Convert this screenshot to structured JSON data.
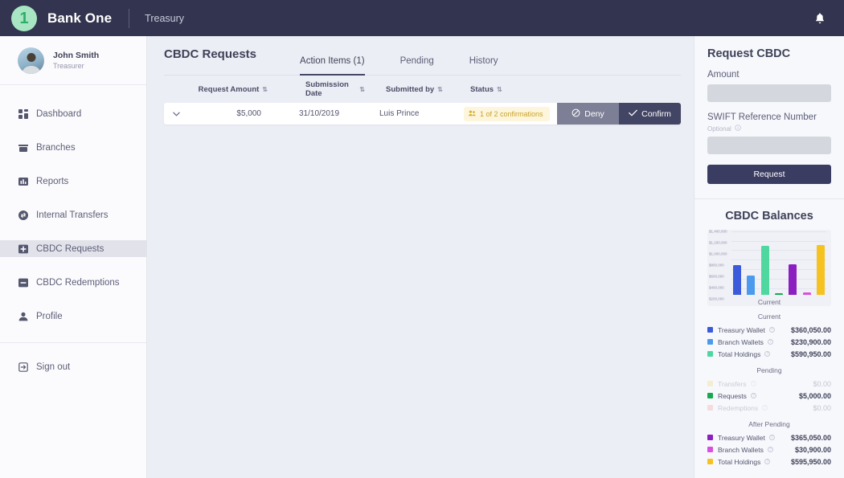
{
  "header": {
    "logo_text": "1",
    "brand": "Bank One",
    "sub_brand": "Treasury",
    "bell_icon": "bell-icon"
  },
  "sidebar": {
    "profile": {
      "name": "John Smith",
      "role": "Treasurer",
      "avatar_icon": "avatar"
    },
    "items": [
      {
        "label": "Dashboard",
        "icon": "dashboard-icon",
        "active": false
      },
      {
        "label": "Branches",
        "icon": "branches-icon",
        "active": false
      },
      {
        "label": "Reports",
        "icon": "reports-icon",
        "active": false
      },
      {
        "label": "Internal Transfers",
        "icon": "transfers-icon",
        "active": false
      },
      {
        "label": "CBDC Requests",
        "icon": "cbdc-requests-icon",
        "active": true
      },
      {
        "label": "CBDC Redemptions",
        "icon": "cbdc-redemptions-icon",
        "active": false
      },
      {
        "label": "Profile",
        "icon": "profile-icon",
        "active": false
      }
    ],
    "signout": {
      "label": "Sign out",
      "icon": "signout-icon"
    }
  },
  "main": {
    "title": "CBDC Requests",
    "tabs": [
      {
        "label": "Action Items (1)",
        "active": true
      },
      {
        "label": "Pending",
        "active": false
      },
      {
        "label": "History",
        "active": false
      }
    ],
    "columns": [
      {
        "label": "Request Amount",
        "sort": "⇅"
      },
      {
        "label": "Submission Date",
        "sort": "⇅"
      },
      {
        "label": "Submitted by",
        "sort": "⇅"
      },
      {
        "label": "Status",
        "sort": "⇅"
      }
    ],
    "rows": [
      {
        "expand_icon": "chevron-down-icon",
        "amount": "$5,000",
        "date": "31/10/2019",
        "submitted_by": "Luis Prince",
        "status": "1 of 2 confirmations",
        "status_icon": "users-icon",
        "deny_label": "Deny",
        "confirm_label": "Confirm"
      }
    ]
  },
  "request_panel": {
    "title": "Request CBDC",
    "amount_label": "Amount",
    "amount_value": "",
    "amount_placeholder": "",
    "swift_label": "SWIFT Reference Number",
    "swift_optional": "Optional",
    "swift_value": "",
    "swift_placeholder": "",
    "button_label": "Request"
  },
  "balances": {
    "title": "CBDC Balances",
    "groups": [
      {
        "name": "Current",
        "faded": false,
        "rows": [
          {
            "label": "Treasury Wallet",
            "value": "$360,050.00",
            "color": "#3b5bdb",
            "faded": false
          },
          {
            "label": "Branch Wallets",
            "value": "$230,900.00",
            "color": "#4c9aed",
            "faded": false
          },
          {
            "label": "Total Holdings",
            "value": "$590,950.00",
            "color": "#4ed8a0",
            "faded": false
          }
        ]
      },
      {
        "name": "Pending",
        "faded": false,
        "rows": [
          {
            "label": "Transfers",
            "value": "$0.00",
            "color": "#f2cf5b",
            "faded": true
          },
          {
            "label": "Requests",
            "value": "$5,000.00",
            "color": "#17a94f",
            "faded": false
          },
          {
            "label": "Redemptions",
            "value": "$0.00",
            "color": "#ef8f8f",
            "faded": true
          }
        ]
      },
      {
        "name": "After Pending",
        "faded": false,
        "rows": [
          {
            "label": "Treasury Wallet",
            "value": "$365,050.00",
            "color": "#8b1fbf",
            "faded": false
          },
          {
            "label": "Branch Wallets",
            "value": "$30,900.00",
            "color": "#d94fe0",
            "faded": false
          },
          {
            "label": "Total Holdings",
            "value": "$595,950.00",
            "color": "#f5c220",
            "faded": false
          }
        ]
      }
    ]
  },
  "chart_data": {
    "type": "bar",
    "title": "CBDC Balances",
    "xlabel": "Current",
    "ylabel": "",
    "grid": true,
    "legend_position": "below",
    "ylim": [
      0,
      1400000
    ],
    "yticks": [
      "$1,400,000",
      "$1,200,000",
      "$1,000,000",
      "$800,000",
      "$600,000",
      "$400,000",
      "$200,000"
    ],
    "categories": [
      "Treasury Wallet",
      "Branch Wallets",
      "Total Holdings",
      "Pending Requests",
      "After Treasury Wallet",
      "After Branch Wallets",
      "After Total Holdings"
    ],
    "values": [
      360050,
      230900,
      590950,
      5000,
      365050,
      30900,
      595950
    ],
    "colors": [
      "#3b5bdb",
      "#4c9aed",
      "#4ed8a0",
      "#17a94f",
      "#8b1fbf",
      "#d94fe0",
      "#f5c220"
    ]
  }
}
